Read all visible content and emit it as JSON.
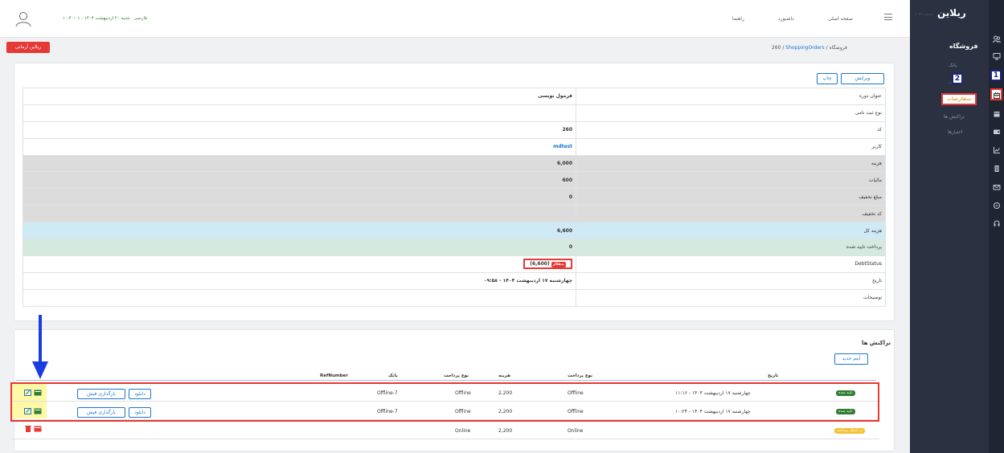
{
  "brand": {
    "logo": "ریلاین",
    "sub": "نسخه ۲.۷۸"
  },
  "topbar": {
    "home": "صفحه اصلی",
    "dashboard": "داشبورد",
    "help": "راهنما",
    "date": "شنبه ۲۰ اردیبهشت ۱۴۰۴ - ۱۰:۴۰:۰۱",
    "lang": "فارسی"
  },
  "btn_red": "ریلاین آرمانی",
  "breadcrumb": {
    "shop": "فروشگاه",
    "orders": "ShoppingOrders",
    "id": "260"
  },
  "nav": {
    "title": "فروشگاه",
    "items": [
      "بانک",
      "...",
      "سفارشات",
      "تراکنش ها",
      "اعتبارها"
    ],
    "callout1": "1",
    "callout2": "2"
  },
  "actions": {
    "edit": "ویرایش",
    "print": "چاپ"
  },
  "details": [
    {
      "label": "عنوان دوره",
      "value": "فرمول نویسی",
      "tone": ""
    },
    {
      "label": "نوع ثبت نامی",
      "value": "",
      "tone": ""
    },
    {
      "label": "کد",
      "value": "260",
      "tone": ""
    },
    {
      "label": "کاربر",
      "value": "mdtest",
      "tone": "link"
    },
    {
      "label": "هزینه",
      "value": "6,000",
      "tone": "gray"
    },
    {
      "label": "مالیات",
      "value": "600",
      "tone": "gray"
    },
    {
      "label": "مبلغ تخفیف",
      "value": "0",
      "tone": "gray"
    },
    {
      "label": "کد تخفیف",
      "value": "",
      "tone": "gray"
    },
    {
      "label": "هزینه کل",
      "value": "6,600",
      "tone": "blue"
    },
    {
      "label": "پرداخت تایید شده",
      "value": "0",
      "tone": "green"
    },
    {
      "label": "DebtStatus",
      "value": "(6,600)",
      "tone": "debt",
      "badge": "بدهکار"
    },
    {
      "label": "تاریخ",
      "value": "چهارشنبه ۱۷ اردیبهشت ۱۴۰۴ - ۰۹:۵۸",
      "tone": ""
    },
    {
      "label": "توضیحات",
      "value": "",
      "tone": ""
    }
  ],
  "transactions": {
    "title": "تراکنش ها",
    "new_item": "آیتم جدید",
    "headers": {
      "date": "تاریخ",
      "pay_type": "نوع پرداخت",
      "cost": "هزینه",
      "pay_type2": "نوع پرداخت",
      "bank": "بانک",
      "ref": "RefNumber"
    },
    "rows": [
      {
        "status": "تایید شده",
        "date": "چهارشنبه ۱۷ اردیبهشت ۱۴۰۴ - ۱۱:۱۶",
        "pay_type": "Offline",
        "cost": "2,200",
        "pay_type2": "Offline",
        "bank": "Offline-7",
        "upload": "بارگذاری فیش",
        "download": "دانلود"
      },
      {
        "status": "تایید شده",
        "date": "چهارشنبه ۱۷ اردیبهشت ۱۴۰۴ - ۱۰:۲۴",
        "pay_type": "Offline",
        "cost": "2,200",
        "pay_type2": "Offline",
        "bank": "Offline-7",
        "upload": "بارگذاری فیش",
        "download": "دانلود"
      },
      {
        "status": "در انتظار پرداخت",
        "date": "",
        "pay_type": "Online",
        "cost": "2,200",
        "pay_type2": "Online",
        "bank": "",
        "upload": "",
        "download": ""
      }
    ]
  }
}
